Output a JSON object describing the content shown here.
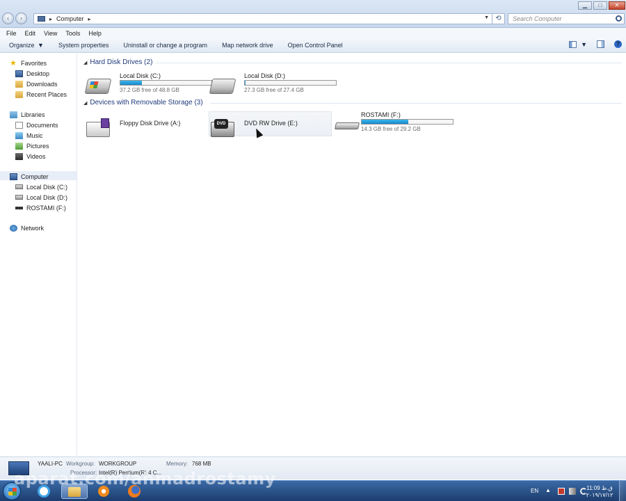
{
  "address": {
    "location": "Computer"
  },
  "search": {
    "placeholder": "Search Computer"
  },
  "menu": [
    "File",
    "Edit",
    "View",
    "Tools",
    "Help"
  ],
  "toolbar": {
    "organize": "Organize",
    "system_properties": "System properties",
    "uninstall": "Uninstall or change a program",
    "map_drive": "Map network drive",
    "control_panel": "Open Control Panel"
  },
  "nav": {
    "favorites": "Favorites",
    "desktop": "Desktop",
    "downloads": "Downloads",
    "recent_places": "Recent Places",
    "libraries": "Libraries",
    "documents": "Documents",
    "music": "Music",
    "pictures": "Pictures",
    "videos": "Videos",
    "computer": "Computer",
    "local_c": "Local Disk (C:)",
    "local_d": "Local Disk (D:)",
    "rostami_f": "ROSTAMI (F:)",
    "network": "Network"
  },
  "groups": {
    "hdd": "Hard Disk Drives (2)",
    "removable": "Devices with Removable Storage (3)"
  },
  "drives": {
    "c": {
      "name": "Local Disk (C:)",
      "free": "37.2 GB free of 48.8 GB",
      "used_fraction": 0.24
    },
    "d": {
      "name": "Local Disk (D:)",
      "free": "27.3 GB free of 27.4 GB",
      "used_fraction": 0.004
    },
    "a": {
      "name": "Floppy Disk Drive (A:)"
    },
    "e": {
      "name": "DVD RW Drive (E:)",
      "badge": "DVD"
    },
    "f": {
      "name": "ROSTAMI (F:)",
      "free": "14.3 GB free of 29.2 GB",
      "used_fraction": 0.51
    }
  },
  "details": {
    "pc_name": "YAALI-PC",
    "workgroup_label": "Workgroup:",
    "workgroup": "WORKGROUP",
    "memory_label": "Memory:",
    "memory": "768 MB",
    "processor_label": "Processor:",
    "processor": "Intel(R) Pentium(R) 4 C..."
  },
  "taskbar": {
    "watermark": "aparat.com/ahmadrostamy",
    "lang": "EN",
    "time": "11:09 ق.ظ",
    "date": "۲۰۱۹/۱۷/۱۲"
  },
  "colors": {
    "accent": "#1b87c9",
    "group_header": "#1e3a7b",
    "taskbar": "#1c3d6e"
  }
}
